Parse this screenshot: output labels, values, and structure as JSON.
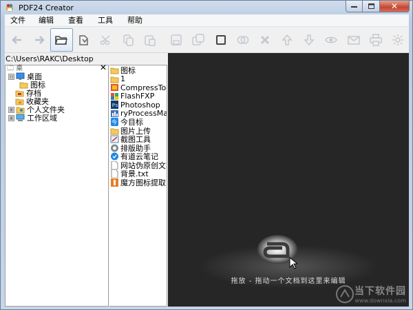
{
  "window": {
    "title": "PDF24 Creator"
  },
  "menu": [
    "文件",
    "编辑",
    "查看",
    "工具",
    "帮助"
  ],
  "toolbar": [
    {
      "name": "back-icon",
      "active": false
    },
    {
      "name": "forward-icon",
      "active": false
    },
    {
      "name": "open-folder-icon",
      "active": true
    },
    {
      "name": "import-icon",
      "active": false
    },
    {
      "name": "cut-icon",
      "active": false
    },
    {
      "name": "copy-icon",
      "active": false
    },
    {
      "name": "paste-icon",
      "active": false
    },
    {
      "name": "save-icon",
      "active": false
    },
    {
      "name": "save-all-icon",
      "active": false
    },
    {
      "name": "select-icon",
      "active": false
    },
    {
      "name": "merge-icon",
      "active": false
    },
    {
      "name": "delete-icon",
      "active": false
    },
    {
      "name": "move-up-icon",
      "active": false
    },
    {
      "name": "move-down-icon",
      "active": false
    },
    {
      "name": "view-icon",
      "active": false
    },
    {
      "name": "mail-icon",
      "active": false
    },
    {
      "name": "print-icon",
      "active": false
    },
    {
      "name": "settings-icon",
      "active": false
    }
  ],
  "path": "C:\\Users\\RAKC\\Desktop",
  "tree": {
    "header_fragment": "🗀 桌",
    "close": "✕",
    "items": [
      {
        "label": "桌面",
        "icon": "desktop-icon",
        "expander": "⊟"
      },
      {
        "label": "图标",
        "icon": "folder-icon",
        "expander": ""
      },
      {
        "label": "存档",
        "icon": "archive-icon",
        "expander": ""
      },
      {
        "label": "收藏夹",
        "icon": "favorites-icon",
        "expander": ""
      },
      {
        "label": "个人文件夹",
        "icon": "user-folder-icon",
        "expander": "⊞"
      },
      {
        "label": "工作区域",
        "icon": "computer-icon",
        "expander": "⊞"
      }
    ]
  },
  "files": [
    {
      "label": "图标",
      "icon": "folder"
    },
    {
      "label": "1",
      "icon": "folder"
    },
    {
      "label": "CompressTool.e",
      "icon": "app-compress"
    },
    {
      "label": "FlashFXP",
      "icon": "app-flashfxp"
    },
    {
      "label": "Photoshop",
      "icon": "app-photoshop"
    },
    {
      "label": "ryProcessManag",
      "icon": "app-process"
    },
    {
      "label": "今目标",
      "icon": "app-jinmubiao"
    },
    {
      "label": "图片上传",
      "icon": "folder"
    },
    {
      "label": "截图工具",
      "icon": "app-snip"
    },
    {
      "label": "排版助手",
      "icon": "app-layout"
    },
    {
      "label": "有道云笔记",
      "icon": "app-youdao"
    },
    {
      "label": "网站伪原创文本",
      "icon": "doc"
    },
    {
      "label": "背景.txt",
      "icon": "doc"
    },
    {
      "label": "魔方图标提取",
      "icon": "app-mofang"
    }
  ],
  "preview": {
    "drop_text": "拖放 - 拖动一个文档到这里来编辑",
    "watermark_main": "当下软件园",
    "watermark_sub": "www.downxia.com"
  }
}
